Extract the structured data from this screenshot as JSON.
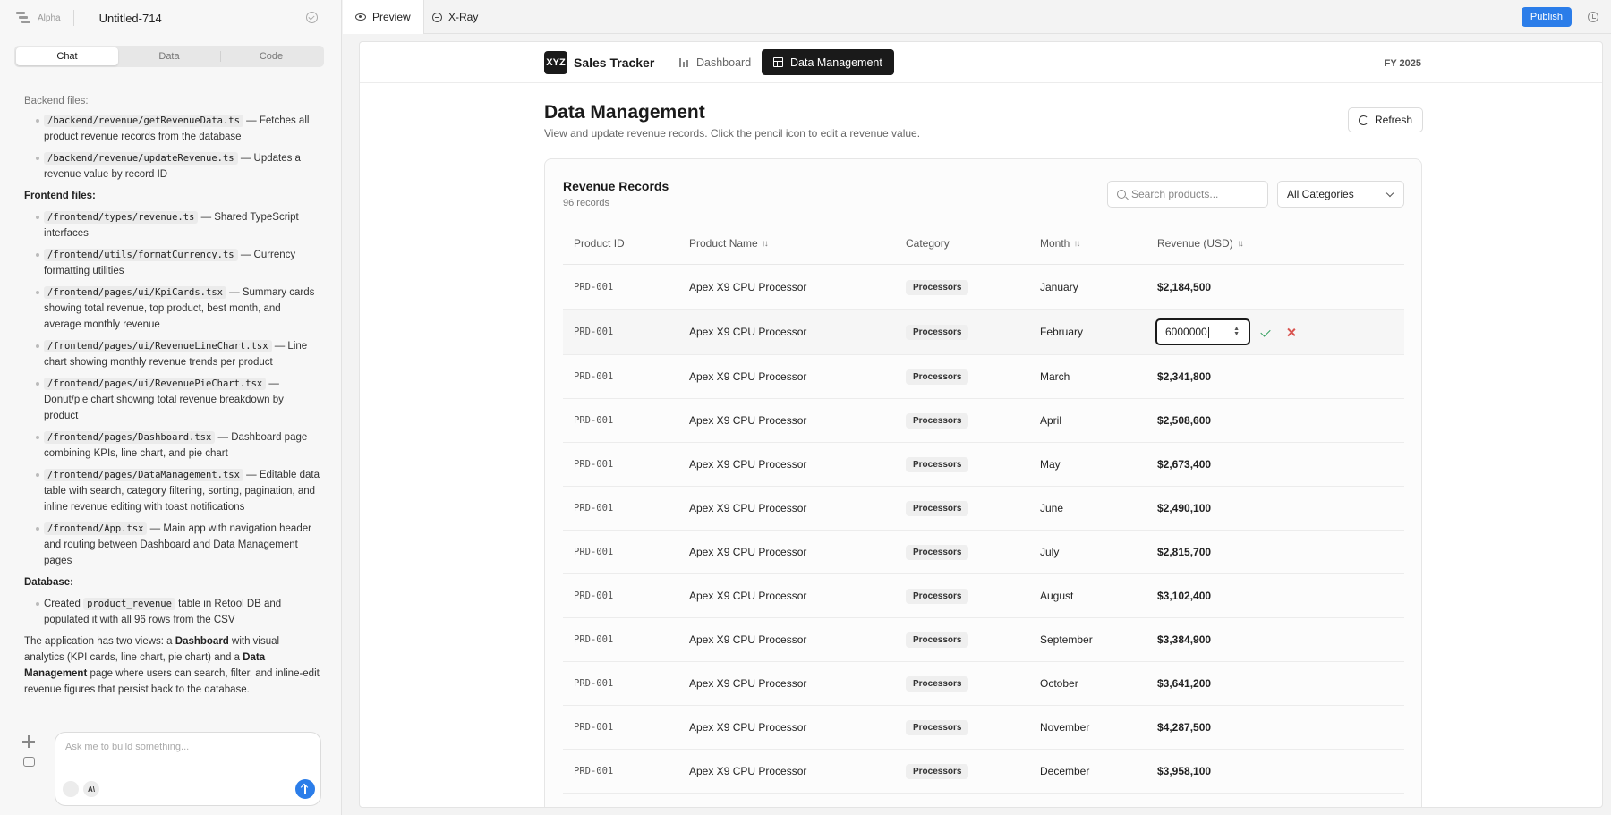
{
  "builder": {
    "badge": "Alpha",
    "project_name": "Untitled-714",
    "left_tabs": [
      "Chat",
      "Data",
      "Code"
    ],
    "top_tabs": [
      "Preview",
      "X-Ray"
    ],
    "publish_label": "Publish",
    "composer_placeholder": "Ask me to build something..."
  },
  "chat": {
    "backend_heading": "Backend files:",
    "backend": [
      {
        "path": "/backend/revenue/getRevenueData.ts",
        "desc": " — Fetches all product revenue records from the database"
      },
      {
        "path": "/backend/revenue/updateRevenue.ts",
        "desc": " — Updates a revenue value by record ID"
      }
    ],
    "frontend_heading": "Frontend files:",
    "frontend": [
      {
        "path": "/frontend/types/revenue.ts",
        "desc": " — Shared TypeScript interfaces"
      },
      {
        "path": "/frontend/utils/formatCurrency.ts",
        "desc": " — Currency formatting utilities"
      },
      {
        "path": "/frontend/pages/ui/KpiCards.tsx",
        "desc": " — Summary cards showing total revenue, top product, best month, and average monthly revenue"
      },
      {
        "path": "/frontend/pages/ui/RevenueLineChart.tsx",
        "desc": " — Line chart showing monthly revenue trends per product"
      },
      {
        "path": "/frontend/pages/ui/RevenuePieChart.tsx",
        "desc": " — Donut/pie chart showing total revenue breakdown by product"
      },
      {
        "path": "/frontend/pages/Dashboard.tsx",
        "desc": " — Dashboard page combining KPIs, line chart, and pie chart"
      },
      {
        "path": "/frontend/pages/DataManagement.tsx",
        "desc": " — Editable data table with search, category filtering, sorting, pagination, and inline revenue editing with toast notifications"
      },
      {
        "path": "/frontend/App.tsx",
        "desc": " — Main app with navigation header and routing between Dashboard and Data Management pages"
      }
    ],
    "database_heading": "Database:",
    "db_prefix": "Created ",
    "db_table": "product_revenue",
    "db_suffix": " table in Retool DB and populated it with all 96 rows from the CSV",
    "summary_1": "The application has two views: a ",
    "summary_b1": "Dashboard",
    "summary_2": " with visual analytics (KPI cards, line chart, pie chart) and a ",
    "summary_b2": "Data Management",
    "summary_3": " page where users can search, filter, and inline-edit revenue figures that persist back to the database."
  },
  "app": {
    "brand_logo": "XYZ",
    "brand_name": "Sales Tracker",
    "nav": [
      "Dashboard",
      "Data Management"
    ],
    "fiscal_year": "FY 2025",
    "page_title": "Data Management",
    "page_subtitle": "View and update revenue records. Click the pencil icon to edit a revenue value.",
    "refresh_label": "Refresh",
    "card_title": "Revenue Records",
    "record_count": "96 records",
    "search_placeholder": "Search products...",
    "category_filter": "All Categories",
    "columns": [
      "Product ID",
      "Product Name",
      "Category",
      "Month",
      "Revenue (USD)"
    ],
    "edit_value": "6000000",
    "rows": [
      {
        "id": "PRD-001",
        "name": "Apex X9 CPU Processor",
        "category": "Processors",
        "month": "January",
        "revenue": "$2,184,500"
      },
      {
        "id": "PRD-001",
        "name": "Apex X9 CPU Processor",
        "category": "Processors",
        "month": "February",
        "revenue": ""
      },
      {
        "id": "PRD-001",
        "name": "Apex X9 CPU Processor",
        "category": "Processors",
        "month": "March",
        "revenue": "$2,341,800"
      },
      {
        "id": "PRD-001",
        "name": "Apex X9 CPU Processor",
        "category": "Processors",
        "month": "April",
        "revenue": "$2,508,600"
      },
      {
        "id": "PRD-001",
        "name": "Apex X9 CPU Processor",
        "category": "Processors",
        "month": "May",
        "revenue": "$2,673,400"
      },
      {
        "id": "PRD-001",
        "name": "Apex X9 CPU Processor",
        "category": "Processors",
        "month": "June",
        "revenue": "$2,490,100"
      },
      {
        "id": "PRD-001",
        "name": "Apex X9 CPU Processor",
        "category": "Processors",
        "month": "July",
        "revenue": "$2,815,700"
      },
      {
        "id": "PRD-001",
        "name": "Apex X9 CPU Processor",
        "category": "Processors",
        "month": "August",
        "revenue": "$3,102,400"
      },
      {
        "id": "PRD-001",
        "name": "Apex X9 CPU Processor",
        "category": "Processors",
        "month": "September",
        "revenue": "$3,384,900"
      },
      {
        "id": "PRD-001",
        "name": "Apex X9 CPU Processor",
        "category": "Processors",
        "month": "October",
        "revenue": "$3,641,200"
      },
      {
        "id": "PRD-001",
        "name": "Apex X9 CPU Processor",
        "category": "Processors",
        "month": "November",
        "revenue": "$4,287,500"
      },
      {
        "id": "PRD-001",
        "name": "Apex X9 CPU Processor",
        "category": "Processors",
        "month": "December",
        "revenue": "$3,958,100"
      }
    ]
  },
  "colors": {
    "accent": "#2b7de9",
    "dark": "#1a1a1a",
    "confirm": "#2f9e5b",
    "cancel": "#d9534f"
  }
}
